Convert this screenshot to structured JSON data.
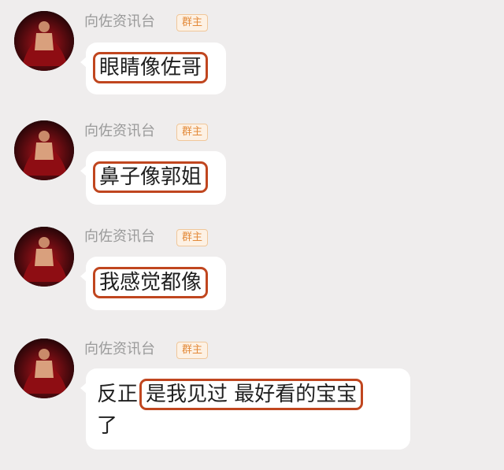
{
  "messages": [
    {
      "sender": "向佐资讯台",
      "badge": "群主",
      "text": "眼睛像佐哥"
    },
    {
      "sender": "向佐资讯台",
      "badge": "群主",
      "text": "鼻子像郭姐"
    },
    {
      "sender": "向佐资讯台",
      "badge": "群主",
      "text": "我感觉都像"
    },
    {
      "sender": "向佐资讯台",
      "badge": "群主",
      "text_prefix": "反正",
      "text_highlight": "是我见过 最好看的宝宝",
      "text_tail": "了"
    }
  ],
  "colors": {
    "highlight_border": "#c0461f",
    "badge_text": "#e38a3a",
    "background": "#efeded"
  }
}
